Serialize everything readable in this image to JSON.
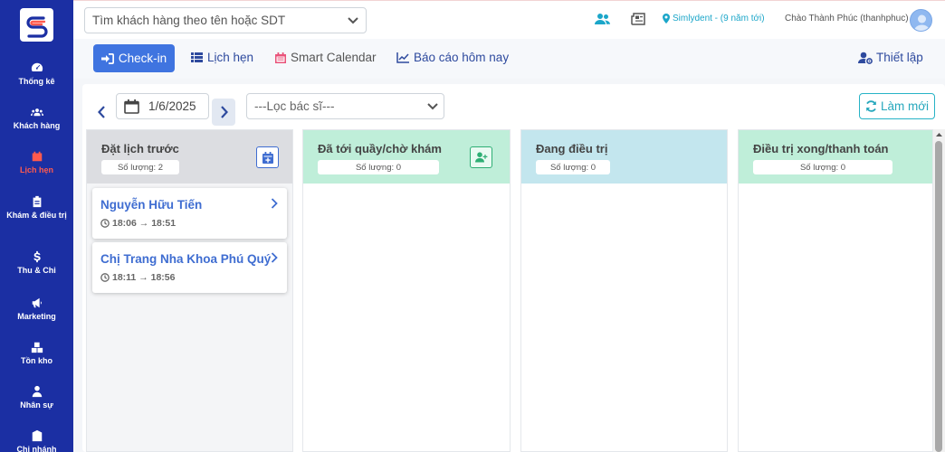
{
  "sidebar": {
    "items": [
      {
        "label": "Thống kê",
        "icon": "dashboard-icon"
      },
      {
        "label": "Khách hàng",
        "icon": "users-icon"
      },
      {
        "label": "Lịch hẹn",
        "icon": "calendar-icon",
        "active": true
      },
      {
        "label": "Khám & điều trị",
        "icon": "clipboard-icon"
      },
      {
        "label": "Thu & Chi",
        "icon": "dollar-icon"
      },
      {
        "label": "Marketing",
        "icon": "megaphone-icon"
      },
      {
        "label": "Tồn kho",
        "icon": "boxes-icon"
      },
      {
        "label": "Nhân sự",
        "icon": "user-tie-icon"
      },
      {
        "label": "Chi nhánh",
        "icon": "building-icon"
      }
    ]
  },
  "topbar": {
    "search_placeholder": "Tìm khách hàng theo tên hoặc SDT",
    "location": "Simlydent - (9 năm tới)",
    "greeting": "Chào Thành Phúc (thanhphuc)"
  },
  "nav": {
    "checkin": "Check-in",
    "appointments": "Lịch hẹn",
    "smart_calendar": "Smart Calendar",
    "report_today": "Báo cáo hôm nay",
    "settings": "Thiết lập"
  },
  "filters": {
    "date": "1/6/2025",
    "doctor_placeholder": "---Lọc bác sĩ---",
    "refresh": "Làm mới"
  },
  "columns": [
    {
      "title": "Đặt lịch trước",
      "count": "Số lượng: 2",
      "color": "#dcdde1"
    },
    {
      "title": "Đã tới quầy/chờ khám",
      "count": "Số lượng: 0",
      "color": "#bfeed9"
    },
    {
      "title": "Đang điều trị",
      "count": "Số lượng: 0",
      "color": "#c3e6ee"
    },
    {
      "title": "Điều trị xong/thanh toán",
      "count": "Số lượng: 0",
      "color": "#bfeed9"
    }
  ],
  "appointments": [
    {
      "name": "Nguyễn Hữu Tiến",
      "time": "18:06 → 18:51"
    },
    {
      "name": "Chị Trang Nha Khoa Phú Quý",
      "time": "18:11 → 18:56"
    }
  ],
  "colors": {
    "sidebar": "#1b2fa3",
    "primary": "#3f74e0",
    "active_menu": "#ff5a4e",
    "teal": "#27b3c6"
  }
}
